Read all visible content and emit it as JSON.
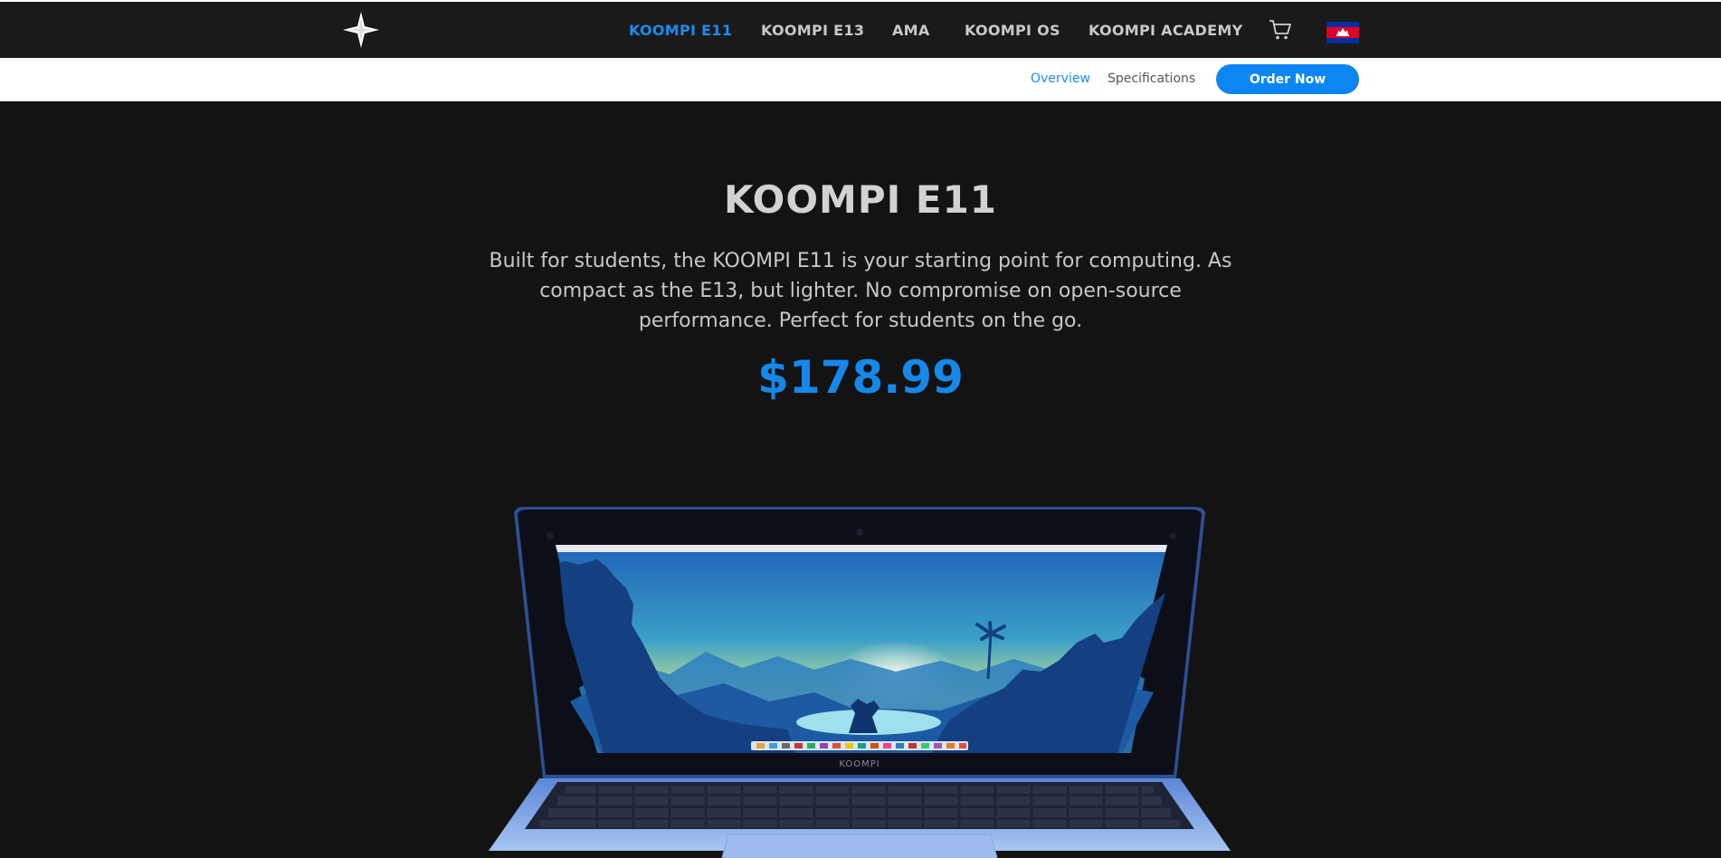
{
  "nav": {
    "items": [
      {
        "label": "KOOMPI E11",
        "active": true
      },
      {
        "label": "KOOMPI E13",
        "active": false
      },
      {
        "label": "AMA",
        "active": false
      },
      {
        "label": "KOOMPI OS",
        "active": false
      },
      {
        "label": "KOOMPI ACADEMY",
        "active": false
      }
    ],
    "cart_icon": "cart-icon",
    "flag_icon": "cambodia-flag-icon"
  },
  "subnav": {
    "overview": "Overview",
    "specifications": "Specifications",
    "order_now": "Order Now"
  },
  "hero": {
    "title": "KOOMPI E11",
    "description": "Built for students, the KOOMPI E11 is your starting point for computing. As compact as the E13, but lighter. No compromise on open-source performance. Perfect for students on the go.",
    "price": "$178.99",
    "laptop_brand": "KOOMPI"
  },
  "colors": {
    "accent": "#1a8cf0",
    "background": "#131313",
    "topbar": "#1a1a1a"
  }
}
